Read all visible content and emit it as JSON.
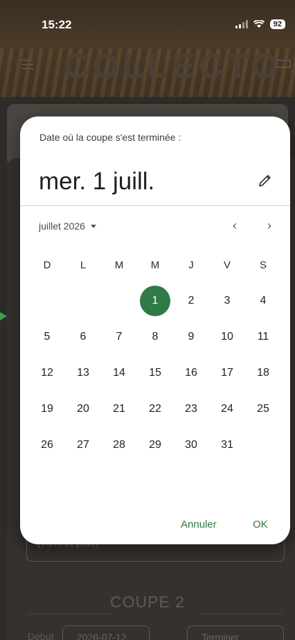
{
  "status_bar": {
    "time": "15:22",
    "battery": "92"
  },
  "app": {
    "logo": "COLLECTO"
  },
  "background": {
    "input_text": "(75% et plus)",
    "section_title": "COUPE 2",
    "debut_label": "Début",
    "debut_value": "2026-07-12",
    "terminer_label": "Terminer"
  },
  "dialog": {
    "header_label": "Date où la coupe s'est terminée :",
    "selected_date": "mer. 1 juill.",
    "month_label": "juillet 2026",
    "weekdays": [
      "D",
      "L",
      "M",
      "M",
      "J",
      "V",
      "S"
    ],
    "weeks": [
      [
        "",
        "",
        "",
        "1",
        "2",
        "3",
        "4"
      ],
      [
        "5",
        "6",
        "7",
        "8",
        "9",
        "10",
        "11"
      ],
      [
        "12",
        "13",
        "14",
        "15",
        "16",
        "17",
        "18"
      ],
      [
        "19",
        "20",
        "21",
        "22",
        "23",
        "24",
        "25"
      ],
      [
        "26",
        "27",
        "28",
        "29",
        "30",
        "31",
        ""
      ]
    ],
    "selected_day": "1",
    "cancel_label": "Annuler",
    "ok_label": "OK"
  },
  "colors": {
    "accent": "#2f7a46",
    "arrow": "#3ca24a"
  },
  "icons": [
    "menu-icon",
    "keyboard-icon",
    "edit-icon",
    "dropdown-icon",
    "chevron-left-icon",
    "chevron-right-icon"
  ]
}
